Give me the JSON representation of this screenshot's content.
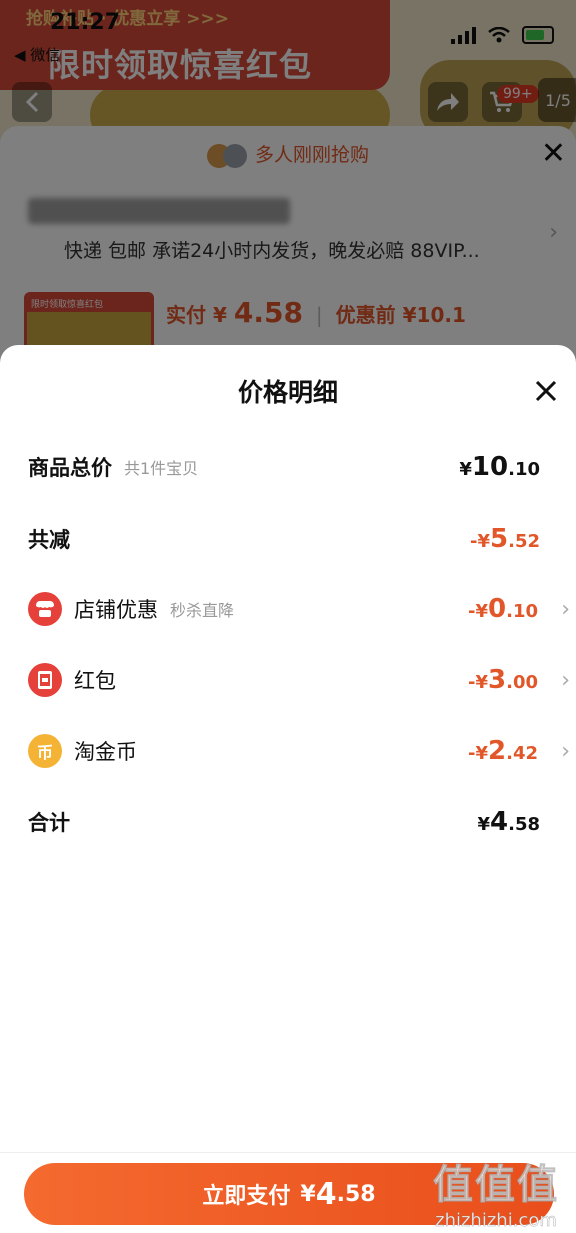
{
  "status": {
    "time": "21:27",
    "back_app": "◀ 微信"
  },
  "banner": {
    "subtitle": "抢购补贴 · 优惠立享 >>>",
    "title": "限时领取惊喜红包"
  },
  "header": {
    "cart_badge": "99+",
    "pager": "1/5"
  },
  "order_sheet": {
    "recent_text": "多人刚刚抢购",
    "shipping_line": "快递 包邮 承诺24小时内发货，晚发必赔 88VIP...",
    "thumb_label": "限时领取惊喜红包",
    "paid_label": "实付",
    "paid_symbol": "¥",
    "paid_amount": "4.58",
    "before_label": "优惠前",
    "before_amount": "¥10.1"
  },
  "panel": {
    "title": "价格明细",
    "rows": [
      {
        "label": "商品总价",
        "sub": "共1件宝贝",
        "prefix": "¥",
        "int": "10",
        "dec": ".10"
      },
      {
        "label": "共减",
        "prefix": "-¥",
        "int": "5",
        "dec": ".52"
      },
      {
        "label": "店铺优惠",
        "sub": "秒杀直降",
        "prefix": "-¥",
        "int": "0",
        "dec": ".10",
        "icon": "store-icon"
      },
      {
        "label": "红包",
        "prefix": "-¥",
        "int": "3",
        "dec": ".00",
        "icon": "red-packet-icon"
      },
      {
        "label": "淘金币",
        "prefix": "-¥",
        "int": "2",
        "dec": ".42",
        "icon": "gold-coin-icon"
      },
      {
        "label": "合计",
        "prefix": "¥",
        "int": "4",
        "dec": ".58"
      }
    ],
    "coin_glyph": "币"
  },
  "footer": {
    "pay_label": "立即支付",
    "prefix": "¥",
    "int": "4",
    "dec": ".58"
  },
  "watermark": {
    "logo": "值值值",
    "url": "zhizhizhi.com"
  },
  "colors": {
    "accent": "#e2572a",
    "pay_start": "#f46a2f",
    "pay_end": "#e94e1b",
    "red_icon": "#e5403a",
    "gold_icon": "#f5b335"
  }
}
